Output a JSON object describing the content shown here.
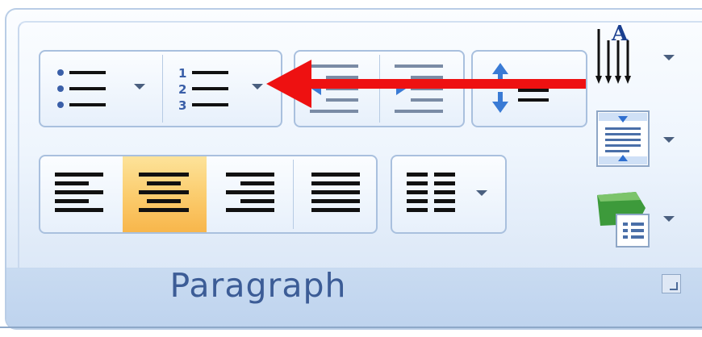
{
  "group": {
    "label": "Paragraph"
  },
  "buttons": {
    "bullets": "bullets",
    "numbering": "numbering",
    "decrease_indent": "decrease-indent",
    "increase_indent": "increase-indent",
    "sort": "sort",
    "align_left": "align-left",
    "center": "center",
    "align_right": "align-right",
    "justify": "justify",
    "columns": "columns",
    "line_spacing": "line-spacing",
    "spacing": "spacing",
    "shading": "shading"
  },
  "state": {
    "active_alignment": "center"
  },
  "colors": {
    "ribbon_border": "#a9c0de",
    "ribbon_bg": "#e7f0fb",
    "footer_bg": "#c9dbf1",
    "label_text": "#3c5c96",
    "highlight": "#fbcd6f",
    "annotation_arrow": "#ee1111"
  }
}
